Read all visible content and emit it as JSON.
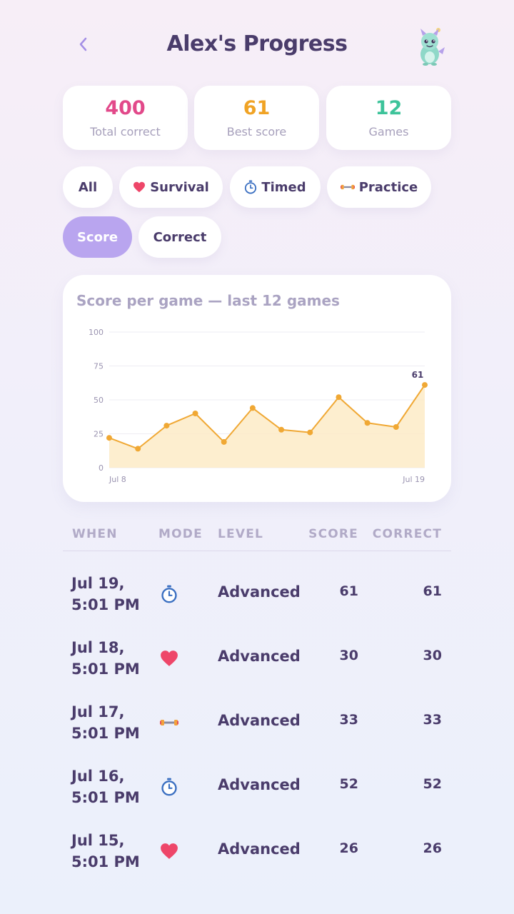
{
  "header": {
    "title": "Alex's Progress"
  },
  "stats": [
    {
      "value": "400",
      "label": "Total correct",
      "color": "#e2498a"
    },
    {
      "value": "61",
      "label": "Best score",
      "color": "#f0a325"
    },
    {
      "value": "12",
      "label": "Games",
      "color": "#3dc39a"
    }
  ],
  "mode_filters": [
    {
      "label": "All",
      "icon": "",
      "active": true
    },
    {
      "label": "Survival",
      "icon": "heart-icon",
      "active": false
    },
    {
      "label": "Timed",
      "icon": "stopwatch-icon",
      "active": false
    },
    {
      "label": "Practice",
      "icon": "dumbbell-icon",
      "active": false
    }
  ],
  "metric_filters": [
    {
      "label": "Score",
      "active": true
    },
    {
      "label": "Correct",
      "active": false
    }
  ],
  "chart_title": "Score per game — last 12 games",
  "chart_data": {
    "type": "area",
    "title": "Score per game — last 12 games",
    "x_start_label": "Jul 8",
    "x_end_label": "Jul 19",
    "values": [
      22,
      14,
      31,
      40,
      19,
      44,
      28,
      26,
      52,
      33,
      30,
      61
    ],
    "ylim": [
      0,
      100
    ],
    "yticks": [
      "100",
      "75",
      "50",
      "25",
      "0"
    ],
    "last_value_label": "61",
    "grid": true,
    "colors": {
      "line": "#f0a834",
      "fill": "#fdebc7",
      "point": "#f0a834"
    }
  },
  "table": {
    "headers": {
      "when": "WHEN",
      "mode": "MODE",
      "level": "LEVEL",
      "score": "SCORE",
      "correct": "CORRECT"
    },
    "rows": [
      {
        "date": "Jul 19,",
        "time": "5:01 PM",
        "mode": "stopwatch-icon",
        "level": "Advanced",
        "score": "61",
        "correct": "61"
      },
      {
        "date": "Jul 18,",
        "time": "5:01 PM",
        "mode": "heart-icon",
        "level": "Advanced",
        "score": "30",
        "correct": "30"
      },
      {
        "date": "Jul 17,",
        "time": "5:01 PM",
        "mode": "dumbbell-icon",
        "level": "Advanced",
        "score": "33",
        "correct": "33"
      },
      {
        "date": "Jul 16,",
        "time": "5:01 PM",
        "mode": "stopwatch-icon",
        "level": "Advanced",
        "score": "52",
        "correct": "52"
      },
      {
        "date": "Jul 15,",
        "time": "5:01 PM",
        "mode": "heart-icon",
        "level": "Advanced",
        "score": "26",
        "correct": "26"
      }
    ]
  }
}
